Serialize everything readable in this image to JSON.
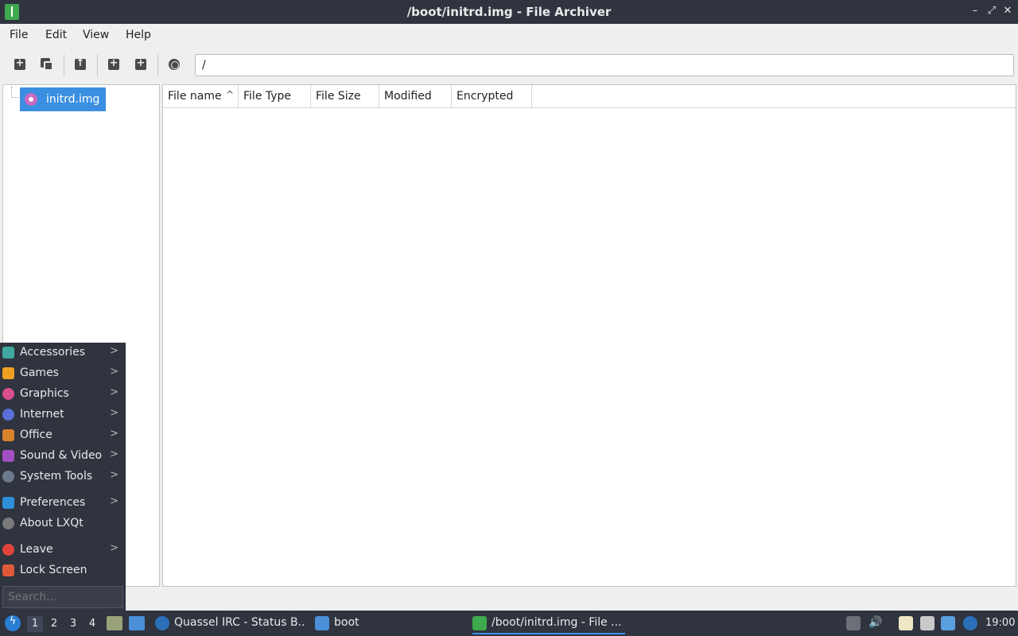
{
  "window": {
    "title": "/boot/initrd.img - File Archiver",
    "controls": {
      "minimize": "–",
      "maximize": "⤢",
      "close": "✕"
    }
  },
  "menubar": {
    "items": [
      "File",
      "Edit",
      "View",
      "Help"
    ]
  },
  "toolbar": {
    "buttons": [
      "new-archive-icon",
      "copy-icon",
      "extract-icon",
      "add-file-icon",
      "add-folder-icon",
      "stop-icon"
    ],
    "path_value": "/"
  },
  "tree": {
    "selected_item": "initrd.img"
  },
  "file_list": {
    "columns": [
      "File name",
      "File Type",
      "File Size",
      "Modified",
      "Encrypted"
    ],
    "sort_indicator": "^",
    "rows": []
  },
  "start_menu": {
    "items": [
      {
        "label": "Accessories",
        "icon": "accessories-icon",
        "color": "#3fa9a0",
        "submenu": true
      },
      {
        "label": "Games",
        "icon": "games-icon",
        "color": "#f0a020",
        "submenu": true
      },
      {
        "label": "Graphics",
        "icon": "graphics-icon",
        "color": "#d94f8f",
        "submenu": true
      },
      {
        "label": "Internet",
        "icon": "internet-icon",
        "color": "#5a6fd8",
        "submenu": true
      },
      {
        "label": "Office",
        "icon": "office-icon",
        "color": "#d9822b",
        "submenu": true
      },
      {
        "label": "Sound & Video",
        "icon": "sound-video-icon",
        "color": "#a24fc4",
        "submenu": true
      },
      {
        "label": "System Tools",
        "icon": "system-tools-icon",
        "color": "#6b7a8c",
        "submenu": true
      },
      {
        "label": "Preferences",
        "icon": "preferences-icon",
        "color": "#2f8fd6",
        "submenu": true
      },
      {
        "label": "About LXQt",
        "icon": "info-icon",
        "color": "#7a7a7a",
        "submenu": false
      },
      {
        "label": "Leave",
        "icon": "power-icon",
        "color": "#e0443a",
        "submenu": true
      },
      {
        "label": "Lock Screen",
        "icon": "lock-icon",
        "color": "#e05a3a",
        "submenu": false
      }
    ],
    "arrow": ">",
    "search_placeholder": "Search..."
  },
  "taskbar": {
    "desktops": [
      "1",
      "2",
      "3",
      "4"
    ],
    "active_desktop": "1",
    "tasks": [
      {
        "label": "Quassel IRC - Status B...",
        "icon": "quassel-icon",
        "color": "#2a6fb8"
      },
      {
        "label": "boot",
        "icon": "folder-icon",
        "color": "#4a8fd8"
      },
      {
        "label": "/boot/initrd.img - File ...",
        "icon": "archiver-icon",
        "color": "#3fa94d"
      }
    ],
    "clock": "19:00"
  },
  "colors": {
    "accent": "#3b8fe0",
    "panel": "#2f343f"
  }
}
